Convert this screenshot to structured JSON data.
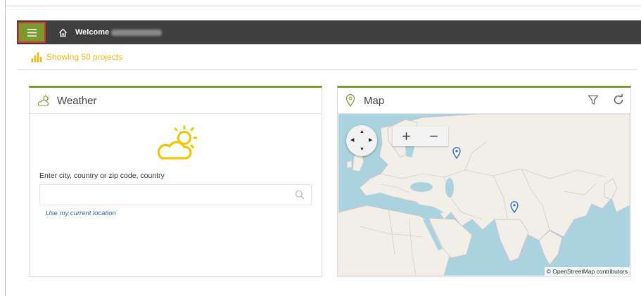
{
  "topbar": {
    "welcome_label": "Welcome"
  },
  "subbar": {
    "projects_text": "Showing 50 projects"
  },
  "weather": {
    "title": "Weather",
    "city_label": "Enter city, country or zip code, country",
    "city_input_value": "",
    "location_link": "Use my current location"
  },
  "map": {
    "title": "Map",
    "zoom_in": "+",
    "zoom_out": "−",
    "attribution": "© OpenStreetMap contributors"
  },
  "colors": {
    "accent_green": "#7a9a2e",
    "topbar": "#3f3f3f",
    "highlight_border": "#d9302a",
    "projects_yellow": "#f2b90c",
    "link_blue": "#2f62b3",
    "pin_blue": "#2d6fcf"
  },
  "icons": {
    "menu": "hamburger-icon",
    "home": "home-icon",
    "projects": "bar-chart-icon",
    "weather_header": "sun-cloud-icon",
    "weather_large": "partly-sunny-icon",
    "search": "search-icon",
    "map_header": "map-pin-icon",
    "filter": "filter-icon",
    "refresh": "refresh-icon",
    "pin": "map-pin-icon"
  }
}
